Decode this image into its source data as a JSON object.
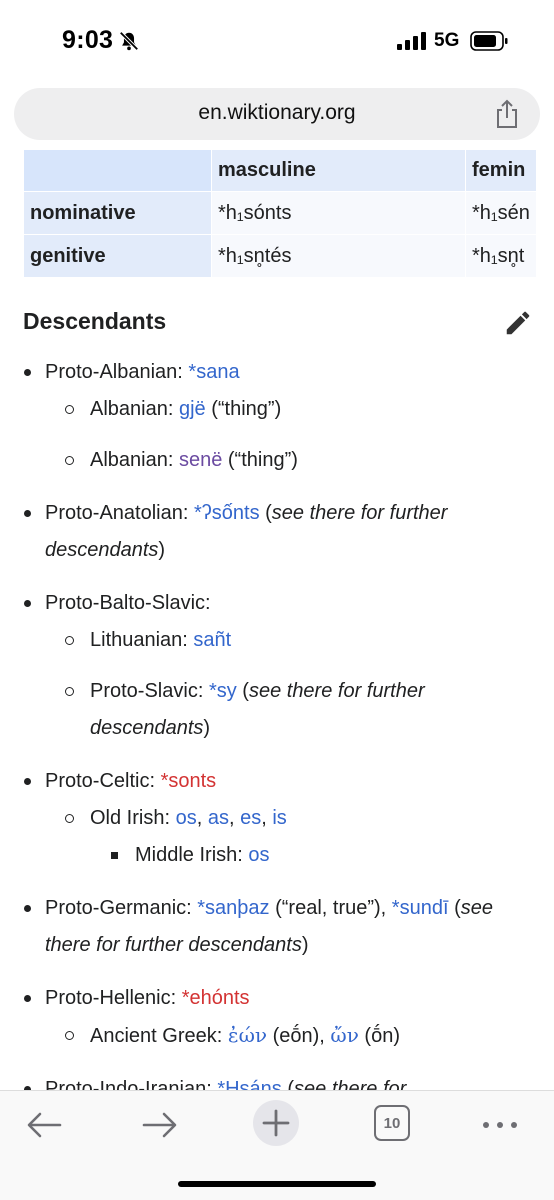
{
  "status": {
    "time": "9:03",
    "network": "5G"
  },
  "browser": {
    "url": "en.wiktionary.org",
    "tab_count": "10"
  },
  "table": {
    "headers": [
      "masculine",
      "femin"
    ],
    "rows": [
      {
        "label": "nominative",
        "masc": "*h₁sónts",
        "fem": "*h₁sén"
      },
      {
        "label": "genitive",
        "masc": "*h₁sn̥tés",
        "fem": "*h₁sn̥t"
      }
    ]
  },
  "section": {
    "title": "Descendants"
  },
  "descendants": {
    "albanian": {
      "lang": "Proto-Albanian: ",
      "term": "*sana",
      "c1_lang": "Albanian: ",
      "c1_term": "gjë",
      "c1_gloss": " (“thing”)",
      "c2_lang": "Albanian: ",
      "c2_term": "senë",
      "c2_gloss": " (“thing”)"
    },
    "anatolian": {
      "lang": "Proto-Anatolian: ",
      "term": "*ʔsốnts",
      "open": " (",
      "note": "see there for further descendants",
      "close": ")"
    },
    "balto_slavic": {
      "lang": "Proto-Balto-Slavic:",
      "c1_lang": "Lithuanian: ",
      "c1_term": "sañt",
      "c2_lang": "Proto-Slavic: ",
      "c2_term": "*sy",
      "c2_open": " (",
      "c2_note": "see there for further descendants",
      "c2_close": ")"
    },
    "celtic": {
      "lang": "Proto-Celtic: ",
      "term": "*sonts",
      "c1_lang": "Old Irish: ",
      "c1_terms": [
        "os",
        "as",
        "es",
        "is"
      ],
      "c1a_lang": "Middle Irish: ",
      "c1a_term": "os"
    },
    "germanic": {
      "lang": "Proto-Germanic: ",
      "term1": "*sanþaz",
      "gloss1": " (“real, true”), ",
      "term2": "*sundī",
      "open": " (",
      "note": "see there for further descendants",
      "close": ")"
    },
    "hellenic": {
      "lang": "Proto-Hellenic: ",
      "term": "*ehónts",
      "c1_lang": "Ancient Greek: ",
      "c1_term1": "ἐών",
      "c1_tr1": " (eṓn), ",
      "c1_term2": "ὤν",
      "c1_tr2": " (ṓn)"
    },
    "indo_iranian": {
      "lang": "Proto-Indo-Iranian: ",
      "term": "*Hsáns",
      "open": " (",
      "note": "see there for"
    }
  },
  "colors": {
    "link": "#3366cc",
    "redlink": "#d33333",
    "visited": "#6b4ba1",
    "header_cell": "#e2ebfa"
  }
}
